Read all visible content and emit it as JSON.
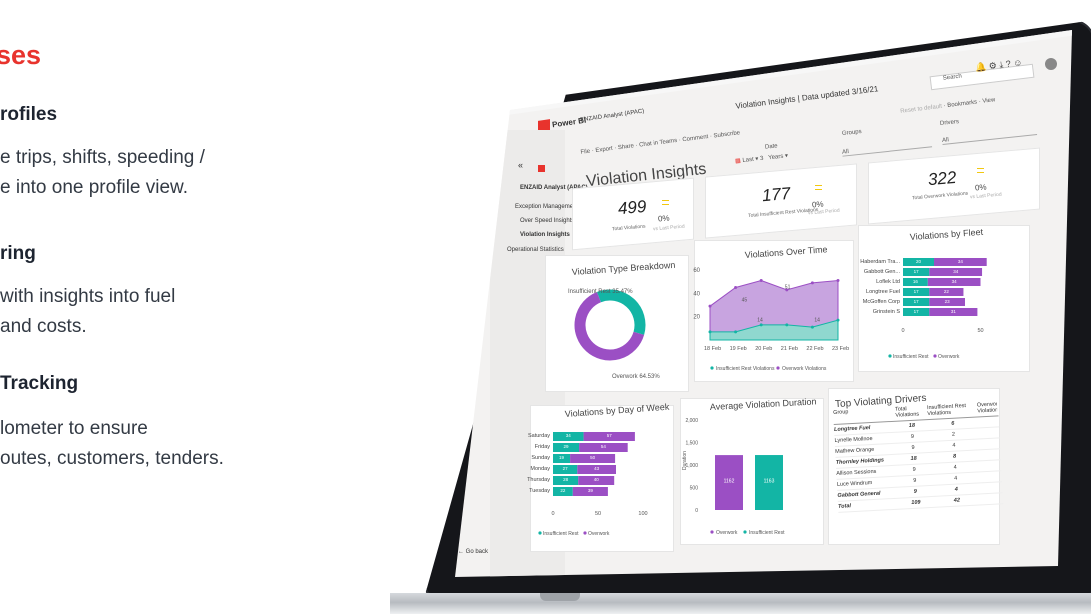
{
  "left": {
    "heading": "ses",
    "sections": [
      {
        "title": "rofiles",
        "body": "e trips, shifts, speeding /\ne into one profile view."
      },
      {
        "title": "ring",
        "body": "with insights into fuel\n and costs."
      },
      {
        "title": "Tracking",
        "body": "lometer to ensure\noutes, customers, tenders."
      }
    ]
  },
  "app": {
    "brand": "Power BI",
    "workspace": "ENZAID Analyst (APAC)",
    "title": "Violation Insights | Data updated 3/16/21",
    "search_placeholder": "Search",
    "toolbar": [
      "File",
      "Export",
      "Share",
      "Chat in Teams",
      "Comment",
      "Subscribe"
    ],
    "right_toolbar": [
      "Reset to default",
      "Bookmarks",
      "View"
    ],
    "back": "Go back"
  },
  "sidebar": {
    "items": [
      "Exception Management",
      "Over Speed Insights",
      "Violation Insights",
      "Operational Statistics"
    ]
  },
  "filters": {
    "date_label": "Date",
    "date_value": "Last",
    "date_num": "3",
    "date_unit": "Years",
    "groups_label": "Groups",
    "groups_value": "All",
    "drivers_label": "Drivers",
    "drivers_value": "All"
  },
  "page_title": "Violation Insights",
  "kpis": [
    {
      "value": "499",
      "pct": "0%",
      "label": "Total Violations",
      "sub": "vs Last Period"
    },
    {
      "value": "177",
      "pct": "0%",
      "label": "Total Insufficient Rest Violations",
      "sub": "vs Last Period"
    },
    {
      "value": "322",
      "pct": "0%",
      "label": "Total Overwork Violations",
      "sub": "vs Last Period"
    }
  ],
  "colors": {
    "teal": "#13b5a5",
    "purple": "#9b4fc4",
    "light_purple": "#c8a4e0",
    "brand_red": "#e8332d",
    "accent_yellow": "#f2c811"
  },
  "chart_data": [
    {
      "type": "pie",
      "title": "Violation Type Breakdown",
      "labels": [
        "Insufficient Rest",
        "Overwork"
      ],
      "values": [
        35.47,
        64.53
      ],
      "label_texts": [
        "Insufficient Rest 35.47%",
        "Overwork 64.53%"
      ]
    },
    {
      "type": "area",
      "title": "Violations Over Time",
      "x": [
        "18 Feb",
        "19 Feb",
        "20 Feb",
        "21 Feb",
        "22 Feb",
        "23 Feb"
      ],
      "series": [
        {
          "name": "Insufficient Rest Violations",
          "values": [
            7,
            7,
            13,
            13,
            11,
            17
          ]
        },
        {
          "name": "Overwork Violations",
          "values": [
            29,
            45,
            51,
            43,
            49,
            51
          ]
        }
      ],
      "ytick_labels": [
        "20",
        "40",
        "60"
      ],
      "data_labels": [
        "51",
        "45",
        "14",
        "14"
      ]
    },
    {
      "type": "bar",
      "title": "Violations by Fleet",
      "categories": [
        "Haberdam Tra...",
        "Gabbott Gen...",
        "Loflek Ltd",
        "Longtree Fuel",
        "McGoffen Corp",
        "Grinstein S"
      ],
      "series": [
        {
          "name": "Insufficient Rest",
          "values": [
            20,
            17,
            16,
            17,
            17,
            17
          ]
        },
        {
          "name": "Overwork",
          "values": [
            34,
            34,
            34,
            22,
            23,
            31
          ]
        }
      ],
      "xtick_labels": [
        "0",
        "50"
      ]
    },
    {
      "type": "bar",
      "title": "Violations by Day of Week",
      "categories": [
        "Saturday",
        "Friday",
        "Sunday",
        "Monday",
        "Thursday",
        "Tuesday"
      ],
      "series": [
        {
          "name": "Insufficient Rest",
          "values": [
            34,
            29,
            19,
            27,
            28,
            22
          ]
        },
        {
          "name": "Overwork",
          "values": [
            57,
            54,
            50,
            43,
            40,
            39
          ]
        }
      ],
      "xtick_labels": [
        "0",
        "50",
        "100"
      ]
    },
    {
      "type": "bar",
      "title": "Average Violation Duration",
      "categories": [
        "Overwork",
        "Insufficient Rest"
      ],
      "values": [
        1162,
        1163
      ],
      "value_labels": [
        "1162",
        "1163"
      ],
      "ylabel": "Duration",
      "ytick_labels": [
        "0",
        "500",
        "1,000",
        "1,500",
        "2,000"
      ]
    }
  ],
  "top_drivers": {
    "title": "Top Violating Drivers",
    "columns": [
      "Group",
      "Total Violations",
      "Insufficient Rest Violations",
      "Overwork Violations"
    ],
    "rows": [
      {
        "group": "Longtree Fuel",
        "total": "18",
        "rest": "6",
        "bold": true
      },
      {
        "group": "Lynelle Mollnoe",
        "total": "9",
        "rest": "2",
        "bold": false
      },
      {
        "group": "Mathew Orange",
        "total": "9",
        "rest": "4",
        "bold": false
      },
      {
        "group": "Thornley Holdings",
        "total": "18",
        "rest": "8",
        "bold": true
      },
      {
        "group": "Allison Sessions",
        "total": "9",
        "rest": "4",
        "bold": false
      },
      {
        "group": "Luce Windrum",
        "total": "9",
        "rest": "4",
        "bold": false
      },
      {
        "group": "Gabbott General",
        "total": "9",
        "rest": "4",
        "bold": true
      },
      {
        "group": "Total",
        "total": "109",
        "rest": "42",
        "bold": true
      }
    ]
  }
}
